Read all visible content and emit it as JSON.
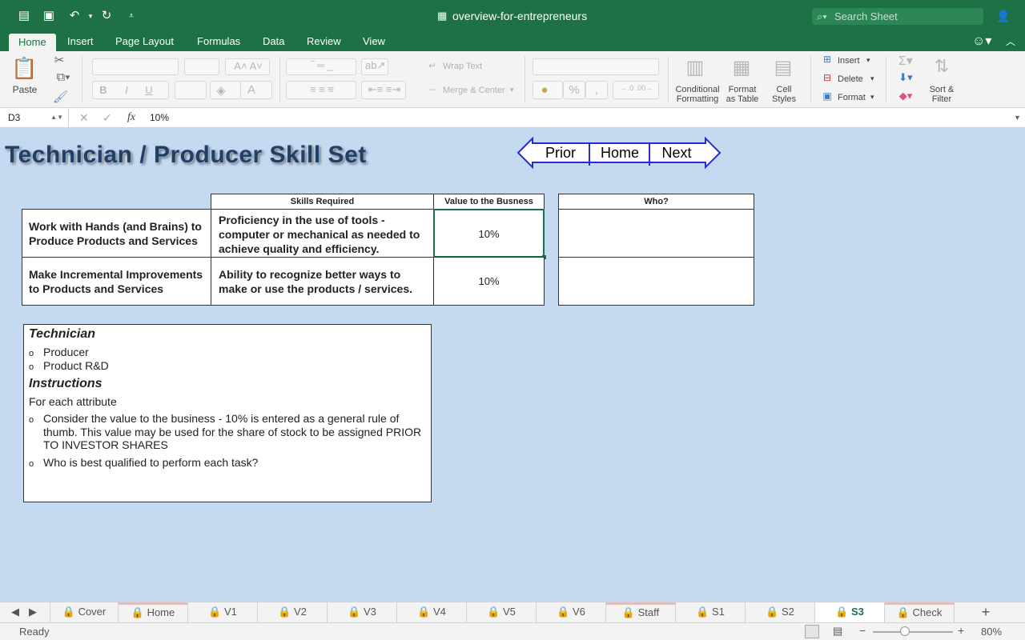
{
  "window": {
    "title": "overview-for-entrepreneurs",
    "search_placeholder": "Search Sheet"
  },
  "ribbon_tabs": [
    "Home",
    "Insert",
    "Page Layout",
    "Formulas",
    "Data",
    "Review",
    "View"
  ],
  "ribbon": {
    "paste": "Paste",
    "wrap_text": "Wrap Text",
    "merge_center": "Merge & Center",
    "conditional_formatting": [
      "Conditional",
      "Formatting"
    ],
    "format_as_table": [
      "Format",
      "as Table"
    ],
    "cell_styles": [
      "Cell",
      "Styles"
    ],
    "insert": "Insert",
    "delete": "Delete",
    "format": "Format",
    "sort_filter": [
      "Sort &",
      "Filter"
    ],
    "bold": "B",
    "italic": "I",
    "underline": "U",
    "percent": "%"
  },
  "formula_bar": {
    "name_box": "D3",
    "fx": "fx",
    "value": "10%"
  },
  "sheet": {
    "title": "Technician / Producer Skill Set",
    "nav": {
      "prior": "Prior",
      "home": "Home",
      "next": "Next"
    },
    "headers": {
      "skills_required": "Skills Required",
      "value": "Value to the Busness",
      "who": "Who?"
    },
    "rows": [
      {
        "attribute": "Work with Hands (and Brains) to Produce Products and Services",
        "skills": "Proficiency in the use of tools - computer or mechanical as needed to achieve quality and efficiency.",
        "value": "10%"
      },
      {
        "attribute": "Make Incremental Improvements to Products and Services",
        "skills": "Ability to recognize better ways to make or use the products / services.",
        "value": "10%"
      }
    ],
    "notes": {
      "heading1": "Technician",
      "item1": "Producer",
      "item2": "Product R&D",
      "heading2": "Instructions",
      "intro": "For each attribute",
      "instr1": "Consider the value to the business - 10% is entered as a general rule of thumb. This value may be used for the share of stock to be assigned PRIOR TO INVESTOR SHARES",
      "instr2": "Who is best qualified to perform each task?",
      "bullet": "o"
    }
  },
  "sheet_tabs": [
    "Cover",
    "Home",
    "V1",
    "V2",
    "V3",
    "V4",
    "V5",
    "V6",
    "Staff",
    "S1",
    "S2",
    "S3",
    "Check"
  ],
  "active_sheet": "S3",
  "status": {
    "text": "Ready",
    "zoom": "80%"
  }
}
